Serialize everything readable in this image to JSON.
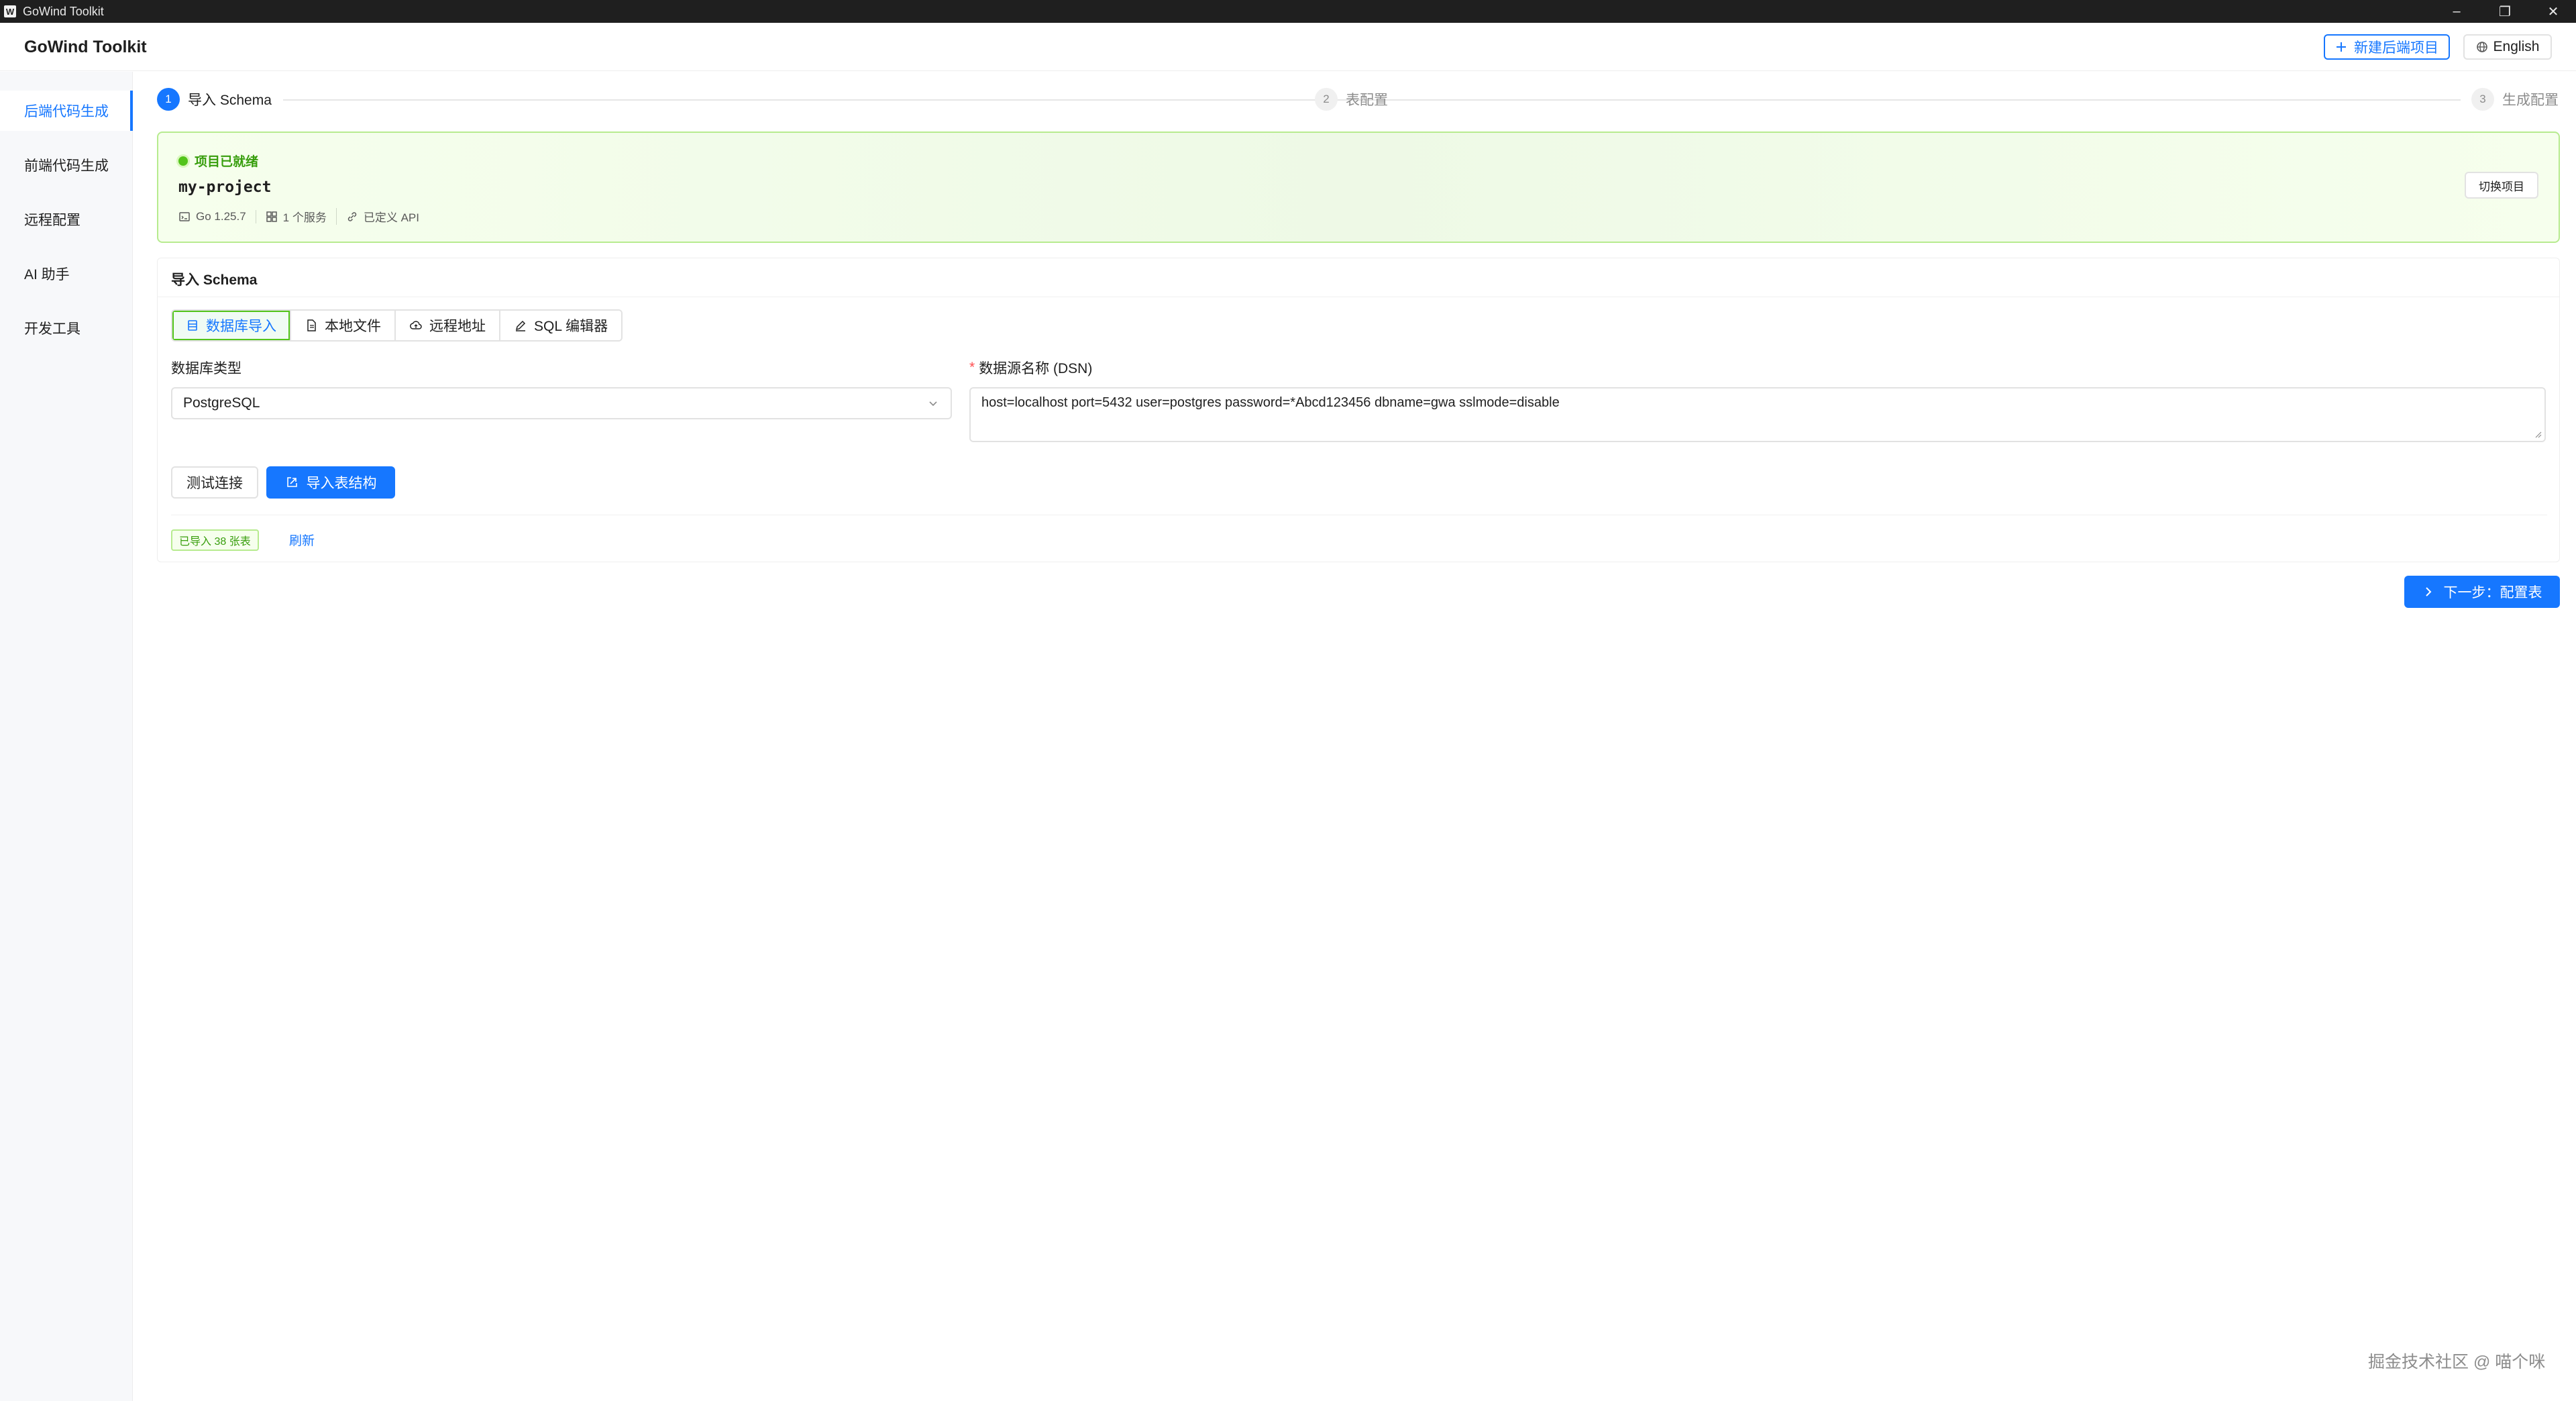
{
  "window": {
    "title": "GoWind Toolkit",
    "app_icon_glyph": "W",
    "controls": {
      "minimize": "–",
      "restore": "❐",
      "close": "✕"
    }
  },
  "header": {
    "brand": "GoWind Toolkit",
    "new_project_label": "新建后端项目",
    "language_label": "English"
  },
  "sidebar": {
    "items": [
      {
        "label": "后端代码生成",
        "active": true
      },
      {
        "label": "前端代码生成",
        "active": false
      },
      {
        "label": "远程配置",
        "active": false
      },
      {
        "label": "AI 助手",
        "active": false
      },
      {
        "label": "开发工具",
        "active": false
      }
    ]
  },
  "steps": [
    {
      "num": "1",
      "label": "导入 Schema",
      "status": "current"
    },
    {
      "num": "2",
      "label": "表配置",
      "status": "wait"
    },
    {
      "num": "3",
      "label": "生成配置",
      "status": "wait"
    }
  ],
  "project": {
    "status": "项目已就绪",
    "name": "my-project",
    "go_version": "Go 1.25.7",
    "services": "1 个服务",
    "api": "已定义 API",
    "switch_label": "切换项目"
  },
  "import": {
    "title": "导入 Schema",
    "tabs": [
      {
        "label": "数据库导入",
        "icon": "database-icon",
        "active": true
      },
      {
        "label": "本地文件",
        "icon": "file-icon",
        "active": false
      },
      {
        "label": "远程地址",
        "icon": "cloud-icon",
        "active": false
      },
      {
        "label": "SQL 编辑器",
        "icon": "edit-icon",
        "active": false
      }
    ],
    "db_type_label": "数据库类型",
    "db_type_value": "PostgreSQL",
    "dsn_label": "数据源名称 (DSN)",
    "dsn_required_mark": "*",
    "dsn_value": "host=localhost port=5432 user=postgres password=*Abcd123456 dbname=gwa sslmode=disable",
    "test_label": "测试连接",
    "import_label": "导入表结构",
    "imported_tag": "已导入 38 张表",
    "refresh_label": "刷新"
  },
  "next_label": "下一步：配置表",
  "watermark": "掘金技术社区 @ 喵个咪",
  "colors": {
    "primary": "#1677ff",
    "success": "#52c41a",
    "success_bg": "#f6ffed",
    "sidebar_bg": "#f7f8fa"
  }
}
